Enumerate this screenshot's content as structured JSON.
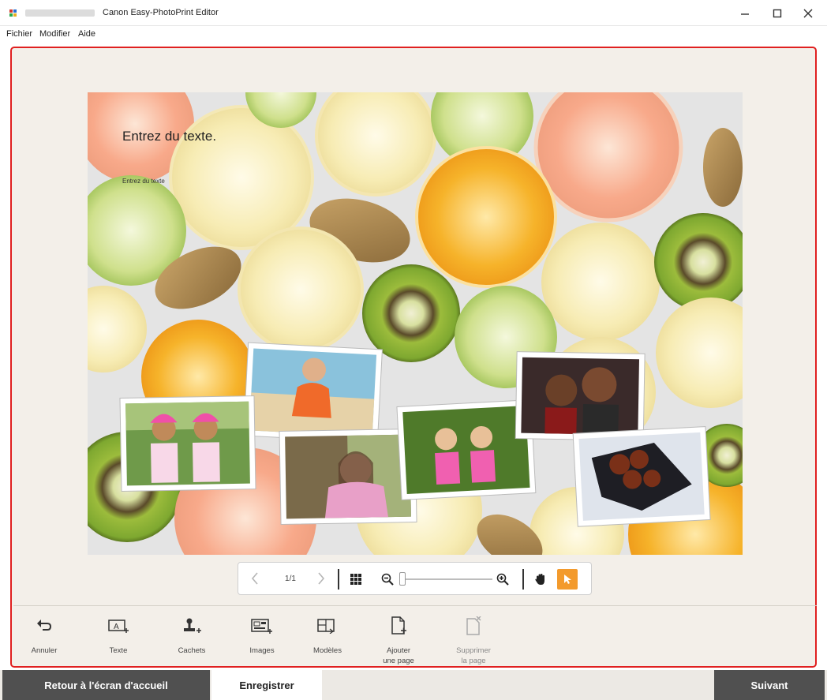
{
  "window": {
    "title": "Canon Easy-PhotoPrint Editor",
    "controls": [
      "minimize-icon",
      "maximize-icon",
      "close-icon"
    ]
  },
  "menu": [
    "Fichier",
    "Modifier",
    "Aide"
  ],
  "canvas": {
    "title_placeholder": "Entrez du texte.",
    "small_placeholder": "Entrez du texte"
  },
  "pager": {
    "page_indicator": "1/1",
    "zoom_level": 0
  },
  "tools": [
    {
      "label": "Annuler",
      "icon": "undo-icon"
    },
    {
      "label": "Texte",
      "icon": "add-text-icon"
    },
    {
      "label": "Cachets",
      "icon": "stamp-icon"
    },
    {
      "label": "Images",
      "icon": "add-image-icon"
    },
    {
      "label": "Modèles",
      "icon": "layout-icon"
    },
    {
      "label": "Ajouter\nune page",
      "icon": "add-page-icon"
    },
    {
      "label": "Supprimer\nla page",
      "icon": "delete-page-icon"
    }
  ],
  "footer": {
    "home": "Retour à l'écran d'accueil",
    "save": "Enregistrer",
    "next": "Suivant"
  },
  "colors": {
    "workspace_border": "#e02020",
    "accent": "#f39a2c",
    "footer_dark": "#505050"
  }
}
